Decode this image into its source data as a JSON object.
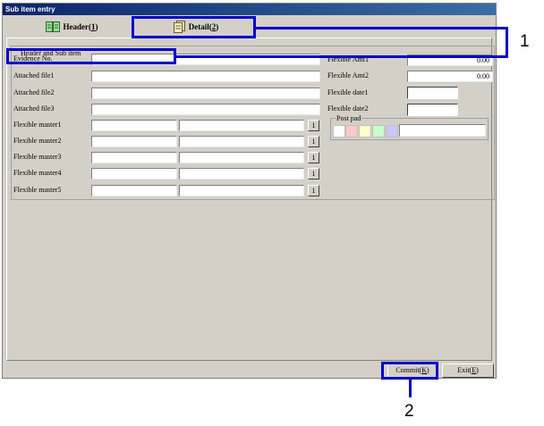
{
  "window": {
    "title": "Sub item entry"
  },
  "tabs": [
    {
      "label": "Header",
      "accel": "1",
      "icon": "book-icon"
    },
    {
      "label": "Detail",
      "accel": "2",
      "icon": "document-icon"
    }
  ],
  "group": {
    "title": "Header and Sub item",
    "evidence_no": {
      "label": "Evidence No.",
      "value": ""
    },
    "attached_files": [
      {
        "label": "Attached file1",
        "value": ""
      },
      {
        "label": "Attached file2",
        "value": ""
      },
      {
        "label": "Attached file3",
        "value": ""
      }
    ],
    "flexible_masters": [
      {
        "label": "Flexible master1",
        "code": "",
        "name": "",
        "button": "1"
      },
      {
        "label": "Flexible master2",
        "code": "",
        "name": "",
        "button": "1"
      },
      {
        "label": "Flexible master3",
        "code": "",
        "name": "",
        "button": "1"
      },
      {
        "label": "Flexible master4",
        "code": "",
        "name": "",
        "button": "1"
      },
      {
        "label": "Flexible master5",
        "code": "",
        "name": "",
        "button": "1"
      }
    ],
    "flexible_amts": [
      {
        "label": "Flexible Amt1",
        "value": "0.00"
      },
      {
        "label": "Flexible Amt2",
        "value": "0.00"
      }
    ],
    "flexible_dates": [
      {
        "label": "Flexible date1",
        "value": ""
      },
      {
        "label": "Flexible date2",
        "value": ""
      }
    ],
    "post_pad": {
      "label": "Post pad",
      "colors": [
        "#ffffff",
        "#ffc8c8",
        "#ffffc8",
        "#c8ffc8",
        "#c8c8ff"
      ]
    }
  },
  "footer": {
    "commit": {
      "label": "Commit",
      "accel": "K"
    },
    "exit": {
      "label": "Exit",
      "accel": "E"
    }
  },
  "callouts": [
    "1",
    "2"
  ]
}
